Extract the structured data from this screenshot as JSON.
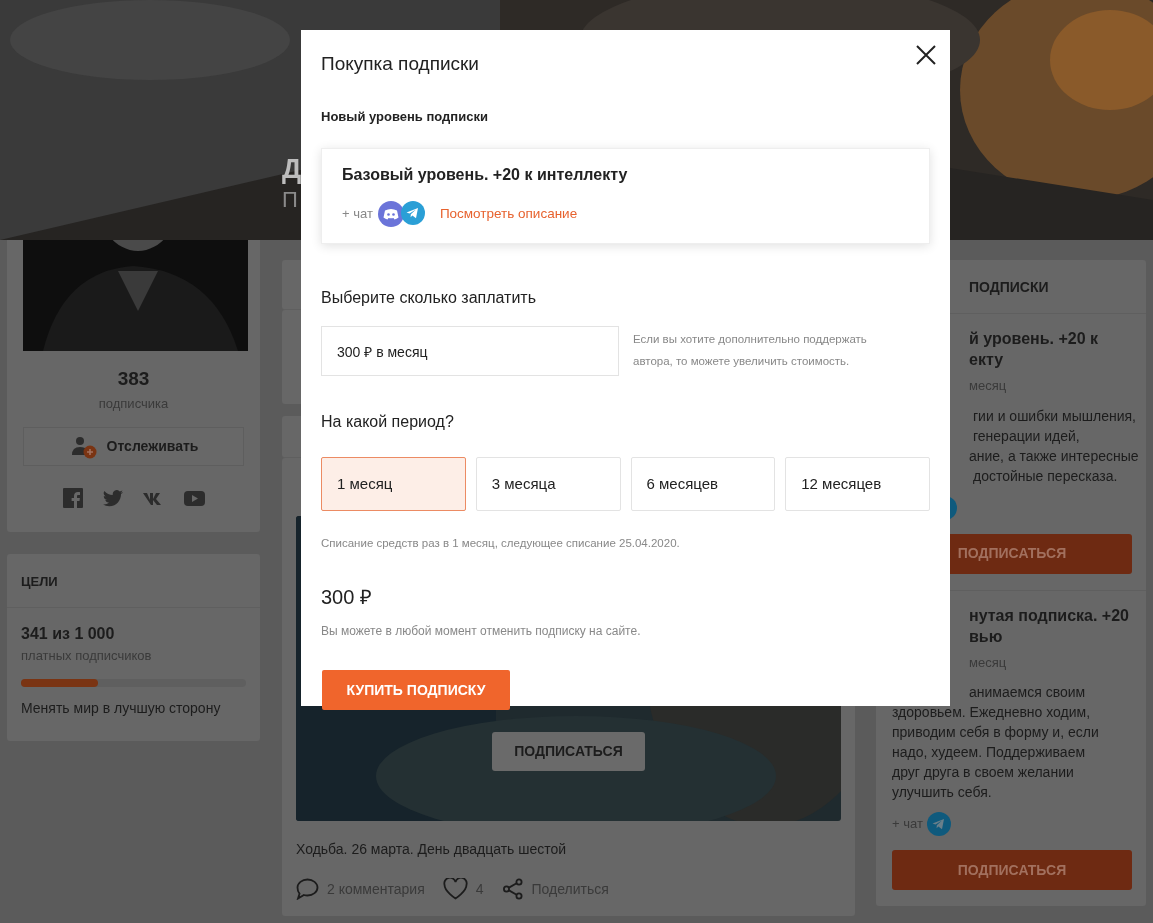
{
  "hero": {
    "name_fragment": "Д",
    "subtitle_fragment": "П"
  },
  "profile": {
    "subscribers_count": "383",
    "subscribers_label": "подписчика",
    "follow_button": "Отслеживать"
  },
  "goals": {
    "title": "ЦЕЛИ",
    "progress_text": "341 из 1 000",
    "progress_label": "платных подписчиков",
    "level": 0.341,
    "description": "Менять мир в лучшую сторону"
  },
  "feed": {
    "post": {
      "locked_button": "ПОДПИСАТЬСЯ",
      "caption": "Ходьба. 26 марта. День двадцать шестой",
      "comments": "2 комментария",
      "likes": "4",
      "share": "Поделиться"
    }
  },
  "subscriptions": {
    "header_fragment": "ПОДПИСКИ",
    "tiers": [
      {
        "title_lines": [
          "й уровень. +20 к",
          "екту"
        ],
        "price_fragment": "месяц",
        "description_lines": [
          "гии и ошибки мышления,",
          "генерации идей,",
          "ание, а также интересные",
          "достойные пересказа."
        ],
        "chat_icons": [
          {
            "kind": "telegram"
          }
        ],
        "button": "ПОДПИСАТЬСЯ"
      },
      {
        "title_lines": [
          "нутая подписка. +20",
          "вью"
        ],
        "price_fragment": "месяц",
        "description_lines": [
          "анимаемся своим",
          "здоровьем. Ежедневно ходим,",
          "приводим себя в форму и, если",
          "надо, худеем. Поддерживаем",
          "друг друга в своем желании",
          "улучшить себя."
        ],
        "chat_label": "+ чат",
        "chat_icons": [
          {
            "kind": "telegram"
          }
        ],
        "button": "ПОДПИСАТЬСЯ"
      }
    ]
  },
  "modal": {
    "title": "Покупка подписки",
    "section_label": "Новый уровень подписки",
    "tier": {
      "title": "Базовый уровень. +20 к интеллекту",
      "chat_label": "+ чат",
      "chat_icons": [
        {
          "kind": "discord"
        },
        {
          "kind": "telegram"
        }
      ],
      "link": "Посмотреть описание"
    },
    "amount_label": "Выберите сколько заплатить",
    "amount_value": "300 ₽ в месяц",
    "amount_hint": "Если вы хотите дополнительно поддержать автора, то можете увеличить стоимость.",
    "period_label": "На какой период?",
    "periods": [
      {
        "label": "1 месяц",
        "selected": true
      },
      {
        "label": "3 месяца",
        "selected": false
      },
      {
        "label": "6 месяцев",
        "selected": false
      },
      {
        "label": "12 месяцев",
        "selected": false
      }
    ],
    "billing_note": "Списание средств раз в 1 месяц, следующее списание 25.04.2020.",
    "total": "300 ₽",
    "cancel_note": "Вы можете в любой момент отменить подписку на сайте.",
    "buy_button": "КУПИТЬ ПОДПИСКУ"
  }
}
